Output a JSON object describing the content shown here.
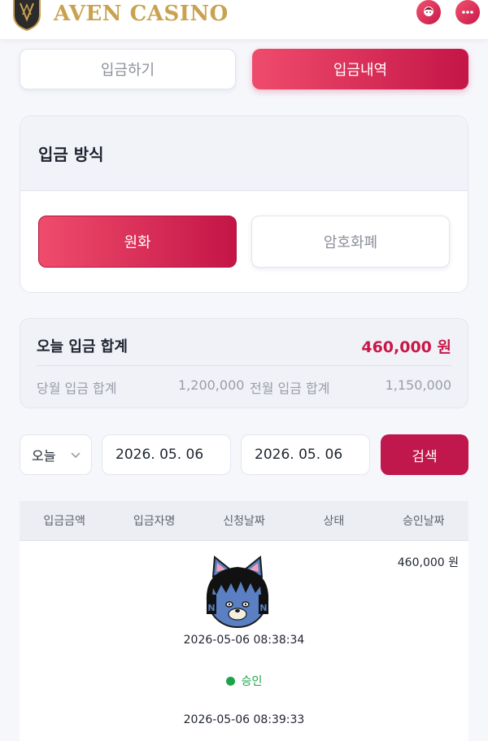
{
  "header": {
    "brand": "AVEN CASINO",
    "logo_letter": "AV",
    "icons": {
      "profile": "user-avatar-icon",
      "chat": "chat-bubble-icon"
    },
    "colors": {
      "brand_gold": "#c9a24f",
      "accent": "#c8184a"
    }
  },
  "tabs": [
    {
      "label": "입금하기",
      "active": false
    },
    {
      "label": "입금내역",
      "active": true
    }
  ],
  "deposit_method": {
    "title": "입금 방식",
    "options": [
      {
        "label": "원화",
        "selected": true
      },
      {
        "label": "암호화폐",
        "selected": false
      }
    ]
  },
  "summary": {
    "today_label": "오늘 입금 합계",
    "today_value": "460,000 원",
    "month_label": "당월 입금 합계",
    "month_value": "1,200,000",
    "prev_month_label": "전월 입금 합계",
    "prev_month_value": "1,150,000"
  },
  "filter": {
    "period": "오늘",
    "date_from": "2026. 05. 06",
    "date_to": "2026. 05. 06",
    "search_label": "검색"
  },
  "table": {
    "columns": [
      "입금금액",
      "입금자명",
      "신청날짜",
      "상태",
      "승인날짜"
    ],
    "rows": [
      {
        "amount": "460,000 원",
        "depositor_avatar": "cat-character-avatar",
        "requested_at": "2026-05-06 08:38:34",
        "status": "승인",
        "status_color": "#1ea34a",
        "approved_at": "2026-05-06 08:39:33"
      }
    ]
  }
}
